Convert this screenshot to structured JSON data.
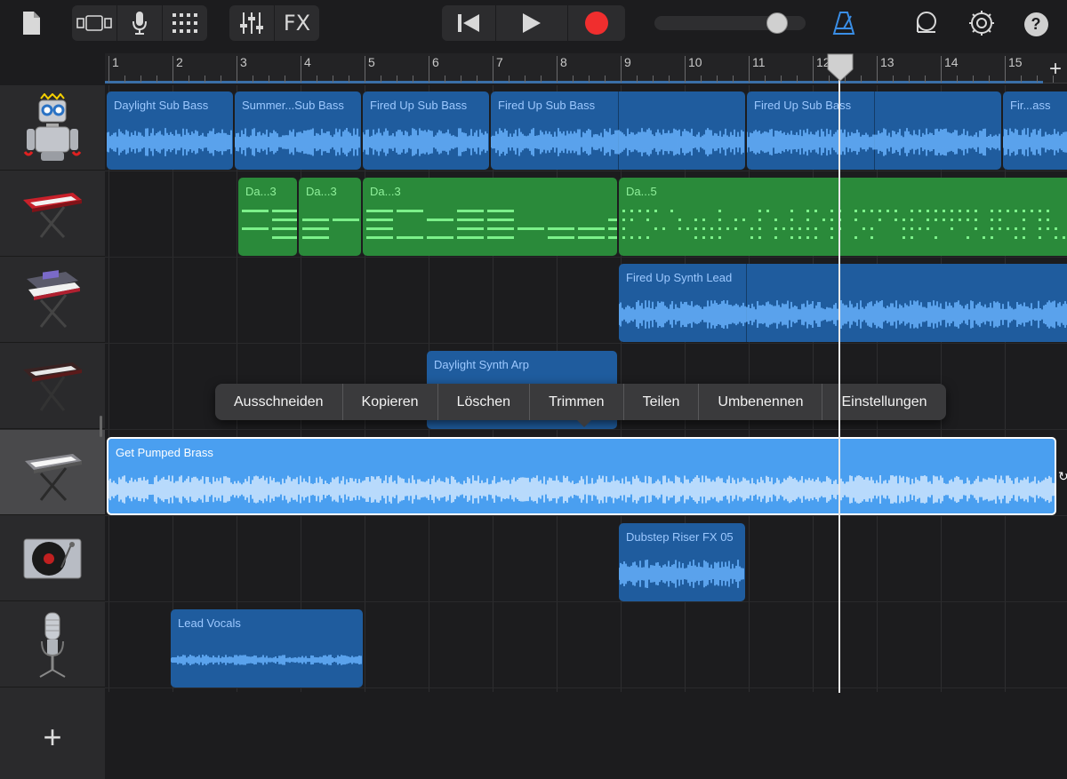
{
  "toolbar": {
    "fx_label": "FX",
    "help_label": "?",
    "accent_color": "#3a8ee6"
  },
  "ruler": {
    "bars": [
      "1",
      "2",
      "3",
      "4",
      "5",
      "6",
      "7",
      "8",
      "9",
      "10",
      "11",
      "12",
      "13",
      "14",
      "15"
    ],
    "add_label": "+"
  },
  "tracks": [
    {
      "name": "bass-robot",
      "icon": "robot-icon"
    },
    {
      "name": "keyboard-red",
      "icon": "keyboard-icon"
    },
    {
      "name": "synth-keyboard",
      "icon": "synth-icon"
    },
    {
      "name": "keyboard-dark",
      "icon": "keyboard-icon"
    },
    {
      "name": "keyboard-brass",
      "icon": "keyboard-icon"
    },
    {
      "name": "turntable",
      "icon": "turntable-icon"
    },
    {
      "name": "microphone",
      "icon": "microphone-icon"
    }
  ],
  "add_track_label": "+",
  "regions": {
    "bass1": "Daylight Sub Bass",
    "bass2": "Summer...Sub Bass",
    "bass3": "Fired Up Sub Bass",
    "bass4": "Fired Up Sub Bass",
    "bass5": "Fired Up Sub Bass",
    "bass6": "Fir...ass",
    "midi1": "Da...3",
    "midi2": "Da...3",
    "midi3": "Da...3",
    "midi4": "Da...5",
    "synth_lead": "Fired Up Synth Lead",
    "arp": "Daylight Synth Arp",
    "brass": "Get Pumped Brass",
    "riser": "Dubstep Riser FX 05",
    "vocals": "Lead Vocals"
  },
  "context_menu": {
    "items": [
      "Ausschneiden",
      "Kopieren",
      "Löschen",
      "Trimmen",
      "Teilen",
      "Umbenennen",
      "Einstellungen"
    ]
  }
}
